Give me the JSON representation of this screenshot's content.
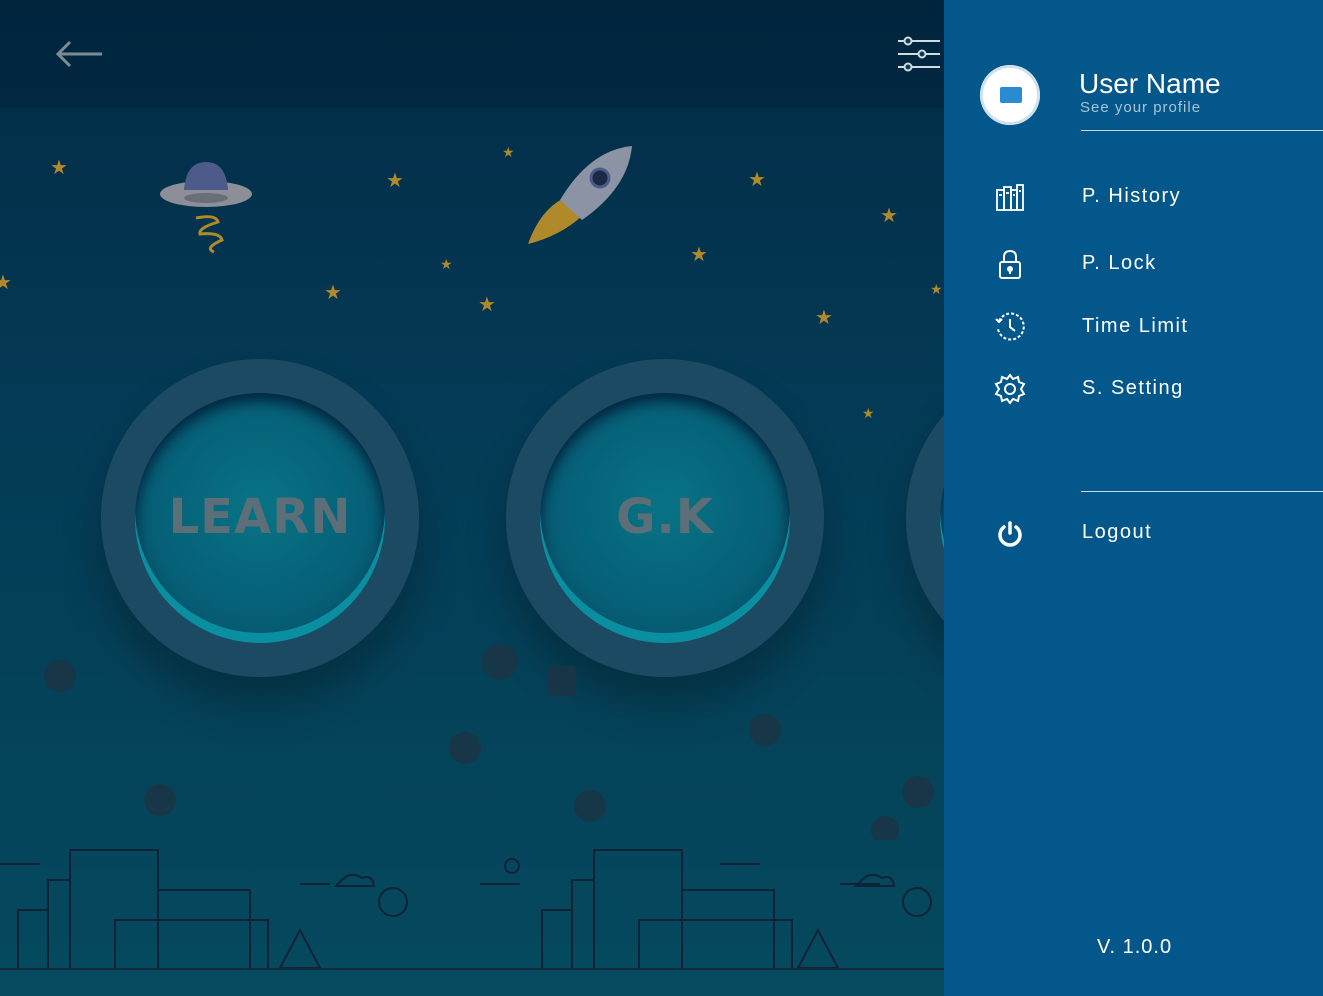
{
  "main": {
    "buttons": [
      {
        "label": "LEARN"
      },
      {
        "label": "G.K"
      }
    ]
  },
  "drawer": {
    "user_name": "User Name",
    "user_sub": "See your profile",
    "menu": [
      {
        "label": "P. History",
        "icon": "books-icon"
      },
      {
        "label": "P. Lock",
        "icon": "lock-icon"
      },
      {
        "label": "Time Limit",
        "icon": "clock-icon"
      },
      {
        "label": "S. Setting",
        "icon": "gear-icon"
      }
    ],
    "logout": "Logout",
    "version": "V. 1.0.0"
  },
  "colors": {
    "drawer_bg": "#03578a",
    "main_bg": "#033450",
    "star": "#b08a2a"
  }
}
